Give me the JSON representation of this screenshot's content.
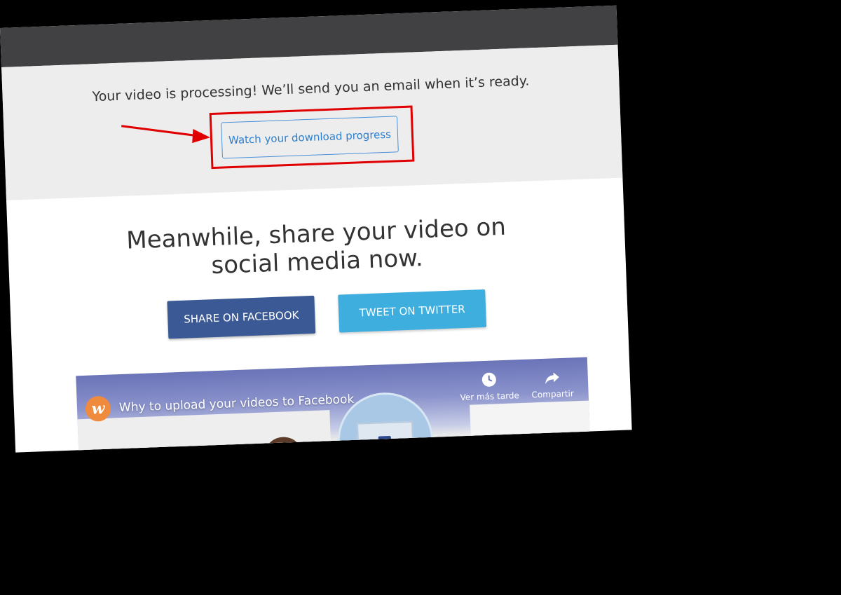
{
  "notice": {
    "message": "Your video is processing! We’ll send you an email when it’s ready.",
    "progress_button_label": "Watch your download progress",
    "highlight_color": "#e00000"
  },
  "share": {
    "headline_line1": "Meanwhile, share your video on",
    "headline_line2": "social media now.",
    "facebook_label": "SHARE ON FACEBOOK",
    "twitter_label": "TWEET ON TWITTER",
    "facebook_color": "#3b5a95",
    "twitter_color": "#3eaede"
  },
  "video": {
    "title": "Why to upload your videos to Facebook",
    "channel_logo_letter": "w",
    "watch_later_label": "Ver más tarde",
    "share_label": "Compartir",
    "fb_glyph": "f",
    "icons": [
      "clock-icon",
      "share-arrow-icon"
    ]
  },
  "colors": {
    "top_bar": "#414143",
    "notice_bg": "#ededed",
    "page_bg": "#ffffff",
    "link_blue": "#2b7fd0"
  }
}
